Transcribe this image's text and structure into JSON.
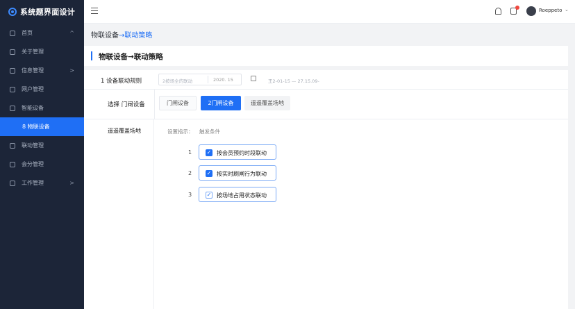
{
  "app": {
    "title": "系统题界面设计"
  },
  "sidebar": {
    "items": [
      {
        "label": "首页",
        "chevron": "^"
      },
      {
        "label": "关于管理"
      },
      {
        "label": "信息管理",
        "chevron": ">"
      },
      {
        "label": "网户管理"
      },
      {
        "label": "智能设备"
      },
      {
        "label": "8 物联设备",
        "active": true
      },
      {
        "label": "联动管理"
      },
      {
        "label": "会分管理"
      },
      {
        "label": "工作管理",
        "chevron": ">"
      }
    ]
  },
  "header": {
    "username": "Roeppeto",
    "user_chevron": "⌄"
  },
  "breadcrumb": {
    "parent": "物联设备",
    "arrow": "→",
    "current": "联动策略"
  },
  "page": {
    "title": "物联设备→联动策略"
  },
  "row1": {
    "label": "1  设备联动规则",
    "input_placeholder": "2按场全的联动",
    "input_value": "2020. 15",
    "range": "王2-01-15 — 27.15.09-"
  },
  "row2": {
    "label": "选择  门闸设备",
    "tabs": [
      "门闸设备",
      "2门闸设备",
      "遥遥覆盖场地"
    ]
  },
  "coverage": {
    "label": "遥遥覆盖场地",
    "hint": "设置指示：",
    "trigger": "触发条件",
    "conditions": [
      {
        "num": "1",
        "text": "按会员预约时段联动"
      },
      {
        "num": "2",
        "text": "按实时刷闸行为联动"
      },
      {
        "num": "3",
        "text": "按场地占用状态联动"
      }
    ]
  },
  "colors": {
    "primary": "#1f6ff5",
    "sidebar_bg": "#1c2538"
  },
  "icons": {
    "logo": "logo-icon",
    "bell": "bell-icon",
    "notice": "notice-icon",
    "menu": "hamburger-icon",
    "calendar": "calendar-icon"
  }
}
